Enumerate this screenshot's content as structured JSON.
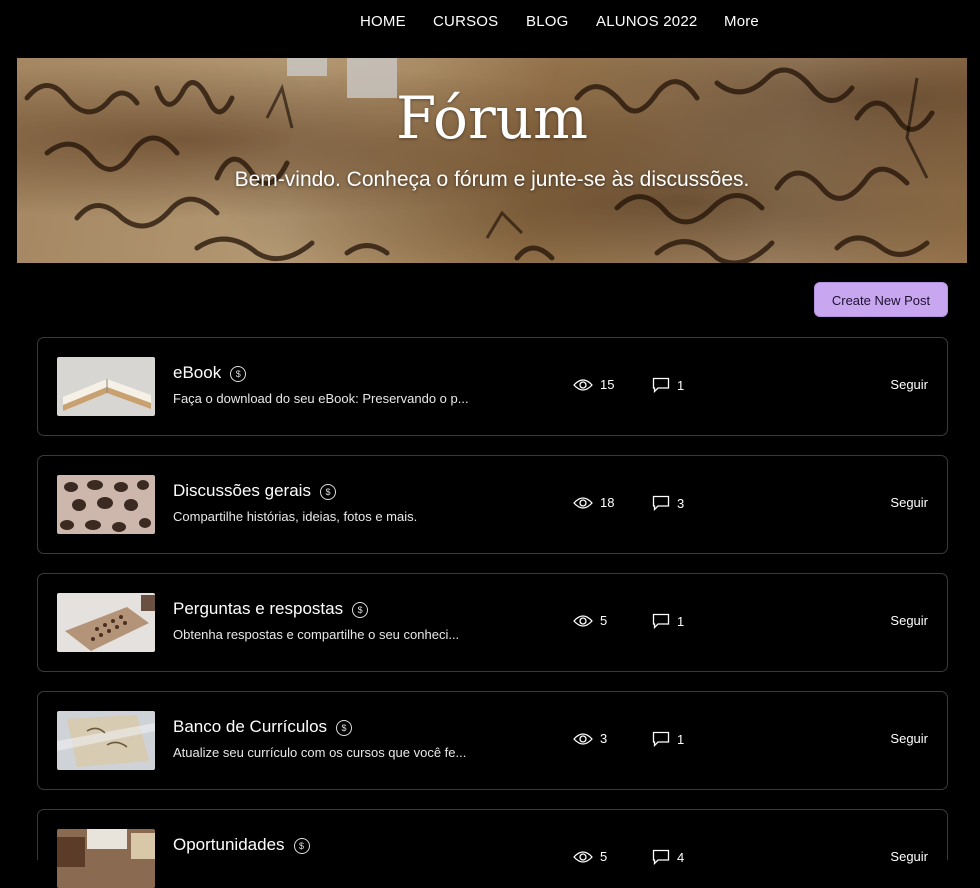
{
  "nav": {
    "items": [
      "HOME",
      "CURSOS",
      "BLOG",
      "ALUNOS 2022",
      "More"
    ]
  },
  "hero": {
    "title": "Fórum",
    "subtitle": "Bem-vindo. Conheça o fórum e junte-se às discussões."
  },
  "actions": {
    "create_post": "Create New Post"
  },
  "categories": [
    {
      "title": "eBook",
      "description": "Faça o download do seu eBook: Preservando o p...",
      "views": "15",
      "comments": "1",
      "follow": "Seguir"
    },
    {
      "title": "Discussões gerais",
      "description": "Compartilhe histórias, ideias, fotos e mais.",
      "views": "18",
      "comments": "3",
      "follow": "Seguir"
    },
    {
      "title": "Perguntas e respostas",
      "description": "Obtenha respostas e compartilhe o seu conheci...",
      "views": "5",
      "comments": "1",
      "follow": "Seguir"
    },
    {
      "title": "Banco de Currículos",
      "description": "Atualize seu currículo com os cursos que você fe...",
      "views": "3",
      "comments": "1",
      "follow": "Seguir"
    },
    {
      "title": "Oportunidades",
      "description": "",
      "views": "5",
      "comments": "4",
      "follow": "Seguir"
    }
  ],
  "colors": {
    "background": "#000000",
    "accent_button": "#c8a6f0",
    "card_border": "#3a3a3a",
    "text": "#ffffff"
  },
  "icons": {
    "paid": "coin-icon",
    "views": "eye-icon",
    "comments": "comment-icon"
  }
}
